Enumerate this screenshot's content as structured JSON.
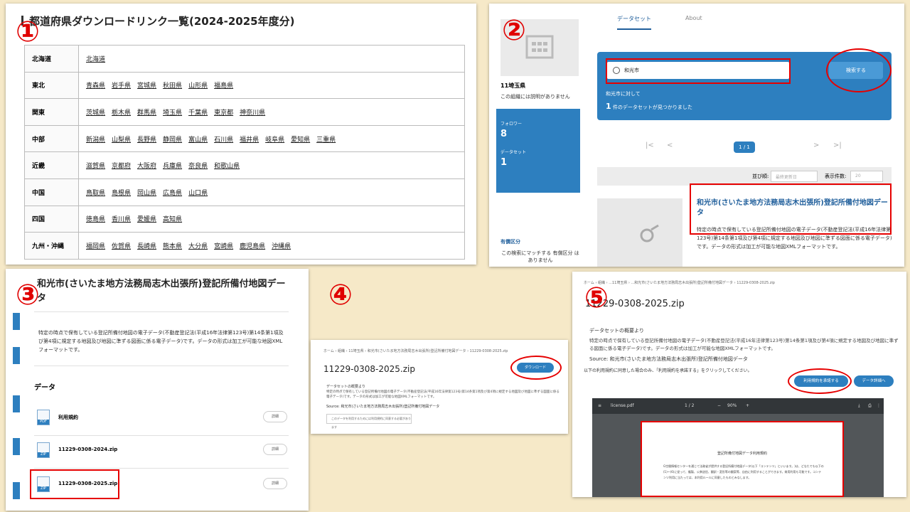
{
  "steps": {
    "s1": "①",
    "s2": "②",
    "s3": "③",
    "s4": "④",
    "s5": "⑤"
  },
  "panel1": {
    "title": "都道府県ダウンロードリンク一覧(2024-2025年度分)",
    "regions": [
      {
        "name": "北海道",
        "prefs": [
          "北海道"
        ]
      },
      {
        "name": "東北",
        "prefs": [
          "青森県",
          "岩手県",
          "宮城県",
          "秋田県",
          "山形県",
          "福島県"
        ]
      },
      {
        "name": "関東",
        "prefs": [
          "茨城県",
          "栃木県",
          "群馬県",
          "埼玉県",
          "千葉県",
          "東京都",
          "神奈川県"
        ]
      },
      {
        "name": "中部",
        "prefs": [
          "新潟県",
          "山梨県",
          "長野県",
          "静岡県",
          "富山県",
          "石川県",
          "福井県",
          "岐阜県",
          "愛知県",
          "三重県"
        ]
      },
      {
        "name": "近畿",
        "prefs": [
          "滋賀県",
          "京都府",
          "大阪府",
          "兵庫県",
          "奈良県",
          "和歌山県"
        ]
      },
      {
        "name": "中国",
        "prefs": [
          "鳥取県",
          "島根県",
          "岡山県",
          "広島県",
          "山口県"
        ]
      },
      {
        "name": "四国",
        "prefs": [
          "徳島県",
          "香川県",
          "愛媛県",
          "高知県"
        ]
      },
      {
        "name": "九州・沖縄",
        "prefs": [
          "福岡県",
          "佐賀県",
          "長崎県",
          "熊本県",
          "大分県",
          "宮崎県",
          "鹿児島県",
          "沖縄県"
        ]
      }
    ]
  },
  "panel2": {
    "tabs": {
      "dataset": "データセット",
      "about": "About"
    },
    "org_name": "11埼玉県",
    "org_desc": "この組織には説明がありません",
    "follower_label": "フォロワー",
    "follower_value": "8",
    "dataset_label": "データセット",
    "dataset_value": "1",
    "search_value": "和光市",
    "search_button": "検索する",
    "result_line1": "和光市に対して",
    "result_count": "1",
    "result_line2": "件のデータセットが見つかりました",
    "page_indicator": "1 / 1",
    "sort_label": "並び順:",
    "sort_value": "最終更新日",
    "count_label": "表示件数:",
    "count_value": "20",
    "facet_title": "有償区分",
    "facet_desc": "この検索にマッチする 有償区分 はありません",
    "result_title": "和光市(さいたま地方法務局志木出張所)登記所備付地図データ",
    "result_desc": "特定の時点で保有している登記所備付地図の電子データ(不動産登記法(平成16年法律第123号)第14条第1項及び第4項に規定する地図及び地図に準ずる図面に係る電子データ)です。データの形式は加工が可能な地図XMLフォーマットです。"
  },
  "panel3": {
    "title": "和光市(さいたま地方法務局志木出張所)登記所備付地図データ",
    "desc": "特定の時点で保有している登記所備付地図の電子データ(不動産登記法(平成16年法律第123号)第14条第1項及び第4項に規定する地図及び地図に準ずる図面に係る電子データ)です。データの形式は加工が可能な地図XMLフォーマットです。",
    "data_heading": "データ",
    "files": [
      {
        "name": "利用規約",
        "type": "PDF",
        "btn": "詳細"
      },
      {
        "name": "11229-0308-2024.zip",
        "type": "ZIP",
        "btn": "詳細"
      },
      {
        "name": "11229-0308-2025.zip",
        "type": "ZIP",
        "btn": "詳細"
      }
    ]
  },
  "panel4": {
    "breadcrumb": "ホーム › 組織 › 11埼玉県 › 和光市(さいたま地方法務局志木出張所)登記所備付地図データ › 11229-0308-2025.zip",
    "filename": "11229-0308-2025.zip",
    "download": "ダウンロード",
    "summary_title": "データセットの概要より",
    "summary_text": "特定の時点で保有している登記所備付地図の電子データ(不動産登記法(平成16年法律第123号)第14条第1項及び第4項に規定する地図及び地図に準ずる図面に係る電子データ)です。データの形式は加工が可能な地図XMLフォーマットです。",
    "source": "Source: 和光市(さいたま地方法務局志木出張所)登記所備付地図データ",
    "agree_note": "このデータを利用するためには利用規約に同意する必要があります"
  },
  "panel5": {
    "breadcrumb": "ホーム › 組織 › ...11埼玉県 › ...和光市(さいたま地方法務局志木出張所)登記所備付地図データ › 11229-0308-2025.zip",
    "filename": "11229-0308-2025.zip",
    "summary_title": "データセットの概要より",
    "summary_text": "特定の時点で保有している登記所備付地図の電子データ(不動産登記法(平成16年法律第123号)第14条第1項及び第4項に規定する地図及び地図に準ずる図面に係る電子データ)です。データの形式は加工が可能な地図XMLフォーマットです。",
    "source": "Source: 和光市(さいたま地方法務局志木出張所)登記所備付地図データ",
    "agree_text": "以下の利用規約に同意した場合のみ、「利用規約を承諾する」をクリックしてください。",
    "accept_button": "利用規約を承諾する",
    "detail_button": "データ詳細へ",
    "pdf_name": "license.pdf",
    "pdf_page": "1 / 2",
    "pdf_zoom": "90%",
    "doc_title": "登記所備付地図データ利用規約",
    "doc_body": "G空間情報センターを通じて法務省が提供する登記所備付地図データ(以下「コンテンツ」といいます。)は、どなたでも以下の(1)〜(6)に従って、複製、公衆送信、翻訳・変形等の翻案等、自由に利用することができます。商用利用も可能です。コンテンツ利用に当たっては、本利用ルールに同意したものとみなします。"
  }
}
